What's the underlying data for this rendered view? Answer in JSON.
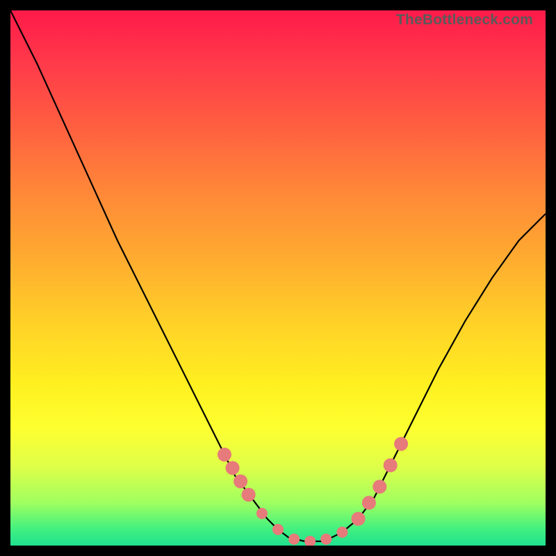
{
  "watermark": "TheBottleneck.com",
  "colors": {
    "curve": "#000000",
    "marker_fill": "#e77a7a",
    "marker_stroke": "#e77a7a",
    "background_top": "#ff1a4a",
    "background_bottom": "#20e090",
    "frame": "#000000"
  },
  "chart_data": {
    "type": "line",
    "title": "",
    "xlabel": "",
    "ylabel": "",
    "xlim": [
      0,
      100
    ],
    "ylim": [
      0,
      100
    ],
    "series": [
      {
        "name": "curve",
        "x": [
          0,
          5,
          10,
          15,
          20,
          25,
          30,
          35,
          40,
          42,
          45,
          48,
          50,
          52,
          55,
          58,
          60,
          62,
          65,
          68,
          70,
          75,
          80,
          85,
          90,
          95,
          100
        ],
        "y": [
          100,
          90,
          79,
          68,
          57,
          47,
          37,
          27,
          17,
          13,
          9,
          5,
          3,
          1.5,
          0.8,
          0.8,
          1.5,
          2.5,
          5,
          9,
          13,
          23,
          33,
          42,
          50,
          57,
          62
        ]
      }
    ],
    "markers": {
      "name": "highlight-points",
      "x": [
        40,
        41.5,
        43,
        44.5,
        47,
        50,
        53,
        56,
        59,
        62,
        65,
        67,
        69,
        71,
        73
      ],
      "y": [
        17,
        14.5,
        12,
        9.5,
        6,
        3,
        1.2,
        0.8,
        1.2,
        2.5,
        5,
        8,
        11,
        15,
        19
      ],
      "r": [
        10,
        10,
        10,
        10,
        8,
        8,
        8,
        8,
        8,
        8,
        10,
        10,
        10,
        10,
        10
      ]
    }
  }
}
